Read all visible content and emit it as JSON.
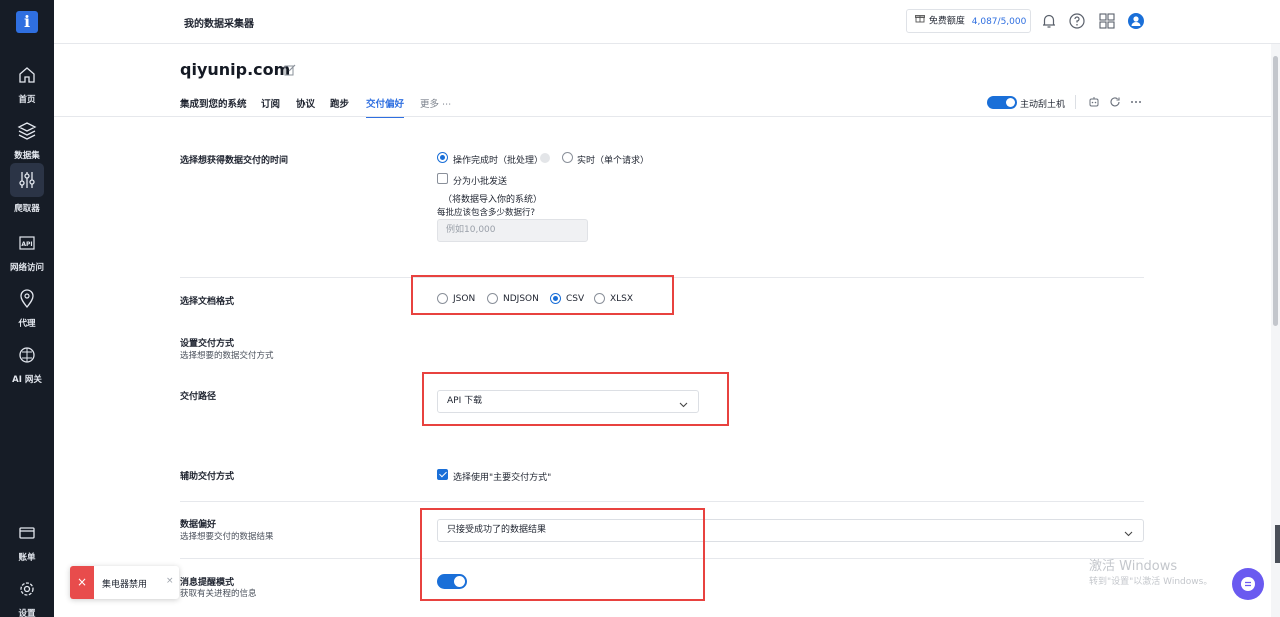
{
  "sidebar": {
    "logo": "i",
    "items": [
      {
        "label": "首页",
        "icon": "home-icon"
      },
      {
        "label": "数据集",
        "icon": "layers-icon"
      },
      {
        "label": "爬取器",
        "icon": "sliders-icon",
        "active": true
      },
      {
        "label": "网络访问",
        "icon": "api-icon"
      },
      {
        "label": "代理",
        "icon": "location-pin-icon"
      },
      {
        "label": "AI 网关",
        "icon": "brain-icon"
      },
      {
        "label": "账单",
        "icon": "card-icon"
      },
      {
        "label": "设置",
        "icon": "gear-icon"
      }
    ]
  },
  "header": {
    "title": "我的数据采集器",
    "quota_label": "免费额度",
    "quota_value": "4,087/5,000"
  },
  "page": {
    "domain": "qiyunip.com",
    "tabs": [
      "集成到您的系统",
      "订阅",
      "协议",
      "跑步",
      "交付偏好",
      "更多 ⋯"
    ],
    "active_tab": "交付偏好",
    "toggle_label": "主动刮土机"
  },
  "form": {
    "delivery_time": {
      "label": "选择想获得数据交付的时间",
      "option_batch": "操作完成时（批处理）",
      "option_realtime": "实时（单个请求）",
      "split_label": "分为小批发送",
      "split_note": "（将数据导入你的系统）",
      "rows_question": "每批应该包含多少数据行?",
      "rows_placeholder": "例如10,000"
    },
    "format": {
      "label": "选择文档格式",
      "options": [
        "JSON",
        "NDJSON",
        "CSV",
        "XLSX"
      ],
      "selected": "CSV"
    },
    "delivery_method": {
      "label": "设置交付方式",
      "sublabel": "选择想要的数据交付方式"
    },
    "delivery_path": {
      "label": "交付路径",
      "value": "API 下载"
    },
    "secondary": {
      "label": "辅助交付方式",
      "checkbox_label": "选择使用\"主要交付方式\""
    },
    "data_pref": {
      "label": "数据偏好",
      "sublabel": "选择想要交付的数据结果",
      "value": "只接受成功了的数据结果"
    },
    "notify": {
      "label": "消息提醒模式",
      "sublabel": "获取有关进程的信息",
      "enabled": true
    }
  },
  "toast": {
    "text": "集电器禁用",
    "close": "×"
  },
  "watermark": {
    "line1": "激活 Windows",
    "line2": "转到\"设置\"以激活 Windows。"
  },
  "colors": {
    "accent": "#1a6fd8",
    "sidebar_bg": "#161c26",
    "annotation_red": "#e8423f"
  }
}
